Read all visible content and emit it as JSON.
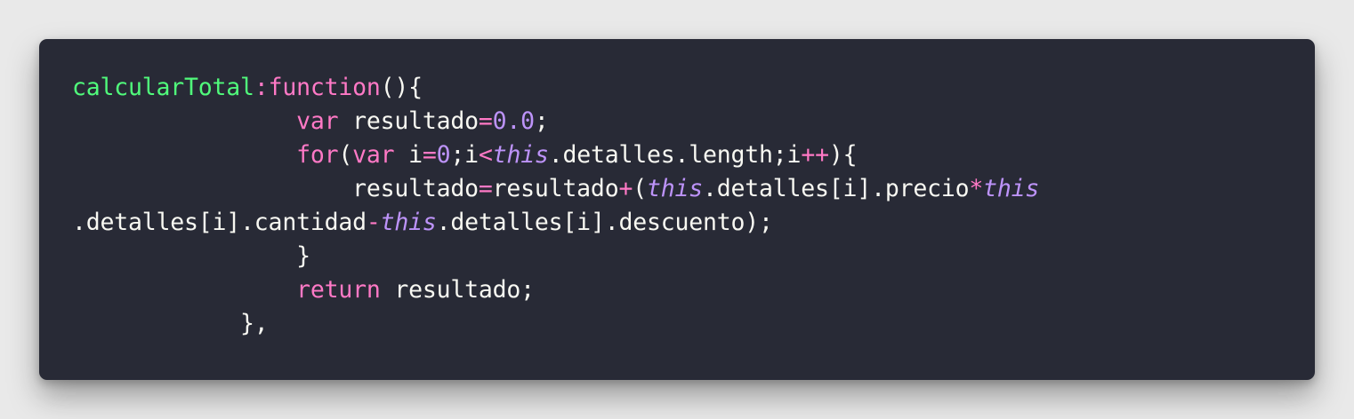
{
  "code_lines": [
    [
      {
        "t": "calcularTotal",
        "c": "fn"
      },
      {
        "t": ":",
        "c": "op"
      },
      {
        "t": "function",
        "c": "kw"
      },
      {
        "t": "(){",
        "c": "pl"
      }
    ],
    [
      {
        "t": "                ",
        "c": "pl"
      },
      {
        "t": "var",
        "c": "kw"
      },
      {
        "t": " resultado",
        "c": "pl"
      },
      {
        "t": "=",
        "c": "op"
      },
      {
        "t": "0.0",
        "c": "num"
      },
      {
        "t": ";",
        "c": "pl"
      }
    ],
    [
      {
        "t": "                ",
        "c": "pl"
      },
      {
        "t": "for",
        "c": "kw"
      },
      {
        "t": "(",
        "c": "pl"
      },
      {
        "t": "var",
        "c": "kw"
      },
      {
        "t": " i",
        "c": "pl"
      },
      {
        "t": "=",
        "c": "op"
      },
      {
        "t": "0",
        "c": "num"
      },
      {
        "t": ";i",
        "c": "pl"
      },
      {
        "t": "<",
        "c": "op"
      },
      {
        "t": "this",
        "c": "th"
      },
      {
        "t": ".detalles.length;i",
        "c": "pl"
      },
      {
        "t": "++",
        "c": "op"
      },
      {
        "t": "){",
        "c": "pl"
      }
    ],
    [
      {
        "t": "                    resultado",
        "c": "pl"
      },
      {
        "t": "=",
        "c": "op"
      },
      {
        "t": "resultado",
        "c": "pl"
      },
      {
        "t": "+",
        "c": "op"
      },
      {
        "t": "(",
        "c": "pl"
      },
      {
        "t": "this",
        "c": "th"
      },
      {
        "t": ".detalles[i].precio",
        "c": "pl"
      },
      {
        "t": "*",
        "c": "op"
      },
      {
        "t": "this",
        "c": "th"
      }
    ],
    [
      {
        "t": ".detalles[i].cantidad",
        "c": "pl"
      },
      {
        "t": "-",
        "c": "op"
      },
      {
        "t": "this",
        "c": "th"
      },
      {
        "t": ".detalles[i].descuento);",
        "c": "pl"
      }
    ],
    [
      {
        "t": "                }",
        "c": "pl"
      }
    ],
    [
      {
        "t": "                ",
        "c": "pl"
      },
      {
        "t": "return",
        "c": "kw"
      },
      {
        "t": " resultado;",
        "c": "pl"
      }
    ],
    [
      {
        "t": "            },",
        "c": "pl"
      }
    ]
  ],
  "colors": {
    "background": "#282a36",
    "default_text": "#f8f8f2",
    "function_name": "#50fa7b",
    "keyword": "#ff79c6",
    "number_and_this": "#bd93f9"
  }
}
